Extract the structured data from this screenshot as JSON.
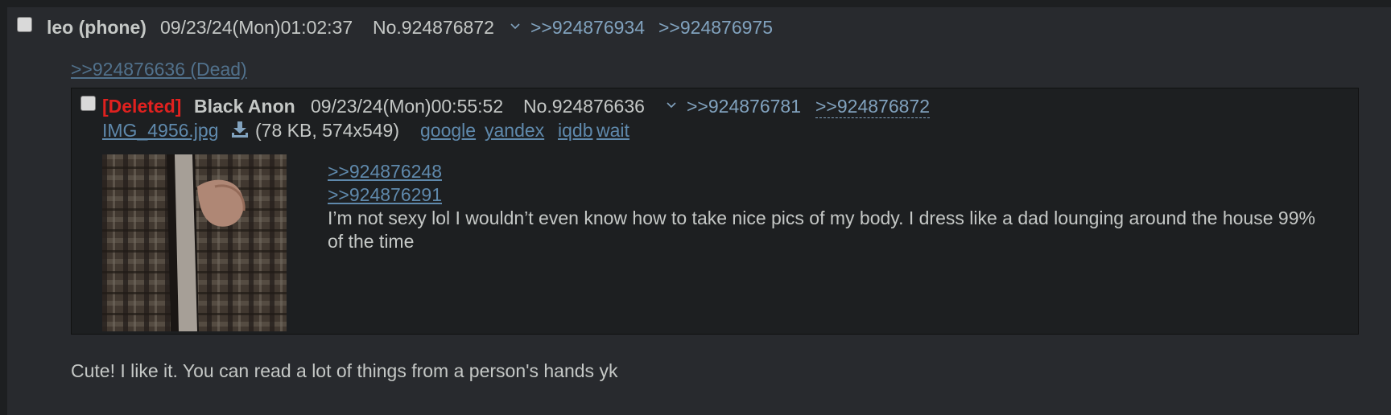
{
  "post": {
    "name": "leo (phone)",
    "datetime": "09/23/24(Mon)01:02:37",
    "post_number": "No.924876872",
    "backlinks": [
      ">>924876934",
      ">>924876975"
    ],
    "dead_quote": ">>924876636 (Dead)",
    "comment": "Cute! I like it. You can read a lot of things from a person's hands yk"
  },
  "quoted_post": {
    "deleted_tag": "[Deleted]",
    "name": "Black Anon",
    "datetime": "09/23/24(Mon)00:55:52",
    "post_number": "No.924876636",
    "backlinks": [
      ">>924876781",
      ">>924876872"
    ],
    "file": {
      "name": "IMG_4956.jpg",
      "meta": "(78 KB, 574x549)",
      "search_links": [
        "google",
        "yandex",
        "iqdb",
        "wait"
      ]
    },
    "quotes": [
      ">>924876248",
      ">>924876291"
    ],
    "comment": "I’m not sexy lol I wouldn’t even know how to take nice pics of my body. I dress like a dad lounging around the house 99% of the time"
  },
  "icons": {
    "menu": "chevron-down-icon",
    "download": "download-icon"
  },
  "colors": {
    "background": "#1d1f21",
    "post_bg": "#282a2e",
    "link": "#81a2be",
    "deleted": "#e0211f",
    "text": "#c5c8c6"
  }
}
